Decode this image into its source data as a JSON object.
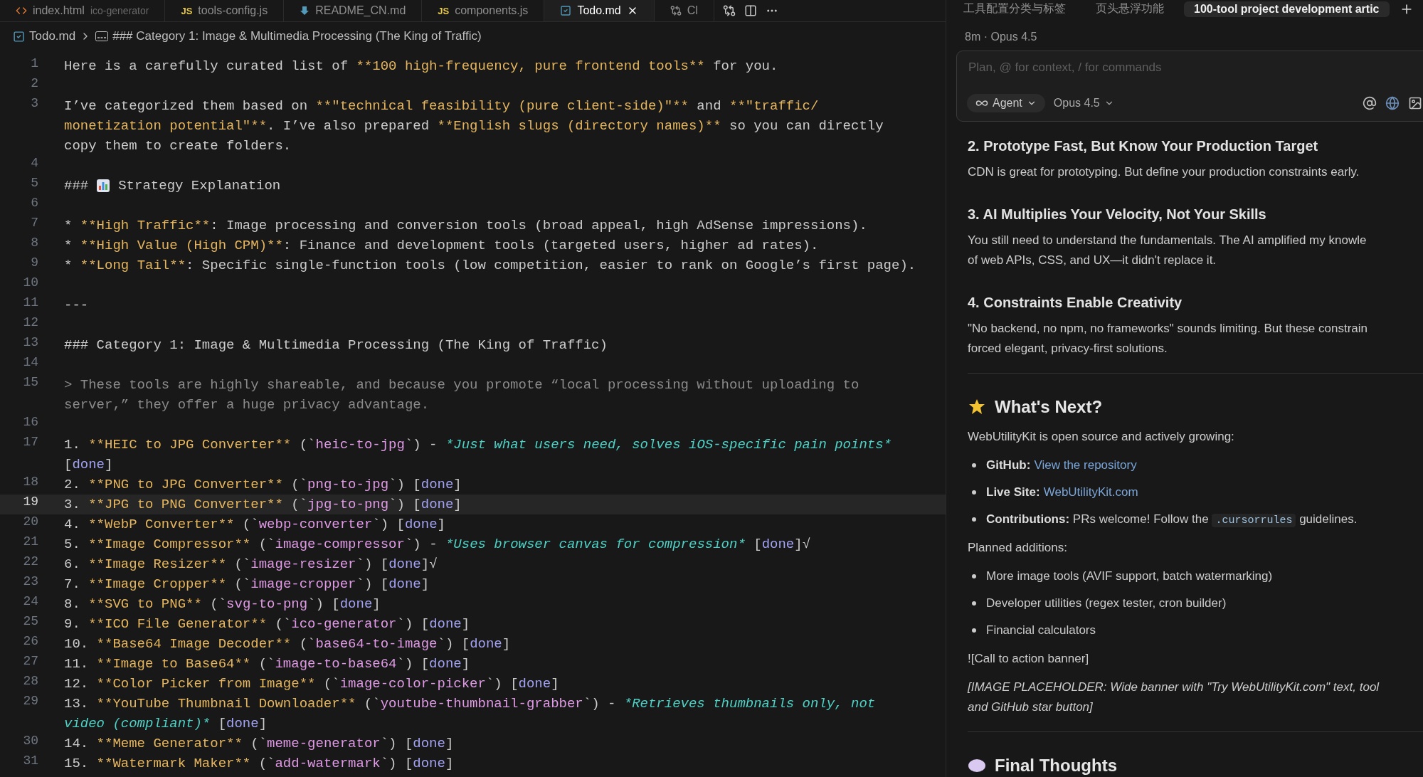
{
  "editor": {
    "tabs": [
      {
        "kind": "html",
        "label": "index.html",
        "detail": "ico-generator",
        "selected": false
      },
      {
        "kind": "js",
        "badge": "JS",
        "label": "tools-config.js",
        "selected": false
      },
      {
        "kind": "readme",
        "label": "README_CN.md",
        "selected": false
      },
      {
        "kind": "js",
        "badge": "JS",
        "label": "components.js",
        "selected": false
      },
      {
        "kind": "md",
        "label": "Todo.md",
        "selected": true
      },
      {
        "kind": "compare",
        "label": "Cl",
        "selected": false
      }
    ],
    "breadcrumb": {
      "file": "Todo.md",
      "symbol": "### Category 1: Image & Multimedia Processing (The King of Traffic)"
    },
    "lines": [
      {
        "number": "1",
        "current": false,
        "wrapped_rows": [
          {
            "segments": [
              {
                "kind": "text",
                "text": "Here is a carefully curated list of "
              },
              {
                "kind": "bold",
                "text": "**100 high-frequency, pure frontend tools**"
              },
              {
                "kind": "text",
                "text": " for you."
              }
            ]
          }
        ]
      },
      {
        "number": "2",
        "current": false
      },
      {
        "number": "3",
        "current": false,
        "wrapped_rows": [
          {
            "segments": [
              {
                "kind": "text",
                "text": "I’ve categorized them based on "
              },
              {
                "kind": "bold",
                "text": "**\"technical feasibility (pure client-side)\"**"
              },
              {
                "kind": "text",
                "text": " and "
              },
              {
                "kind": "bold",
                "text": "**\"traffic/"
              }
            ]
          },
          {
            "segments": [
              {
                "kind": "bold",
                "text": "monetization potential\"**"
              },
              {
                "kind": "text",
                "text": ". I’ve also prepared "
              },
              {
                "kind": "bold",
                "text": "**English slugs (directory names)**"
              },
              {
                "kind": "text",
                "text": " so you can directly"
              }
            ]
          },
          {
            "segments": [
              {
                "kind": "text",
                "text": "copy them to create folders."
              }
            ]
          }
        ]
      },
      {
        "number": "4",
        "current": false
      },
      {
        "number": "5",
        "current": false,
        "wrapped_rows": [
          {
            "segments": [
              {
                "kind": "text",
                "text": "###"
              },
              {
                "kind": "icon"
              },
              {
                "kind": "text",
                "text": "Strategy Explanation"
              }
            ]
          }
        ]
      },
      {
        "number": "6",
        "current": false
      },
      {
        "number": "7",
        "current": false,
        "wrapped_rows": [
          {
            "segments": [
              {
                "kind": "text",
                "text": "* "
              },
              {
                "kind": "bold",
                "text": "**High Traffic**"
              },
              {
                "kind": "text",
                "text": ": Image processing and conversion tools (broad appeal, high AdSense impressions)."
              }
            ]
          }
        ]
      },
      {
        "number": "8",
        "current": false,
        "wrapped_rows": [
          {
            "segments": [
              {
                "kind": "text",
                "text": "* "
              },
              {
                "kind": "bold",
                "text": "**High Value (High CPM)**"
              },
              {
                "kind": "text",
                "text": ": Finance and development tools (targeted users, higher ad rates)."
              }
            ]
          }
        ]
      },
      {
        "number": "9",
        "current": false,
        "wrapped_rows": [
          {
            "segments": [
              {
                "kind": "text",
                "text": "* "
              },
              {
                "kind": "bold",
                "text": "**Long Tail**"
              },
              {
                "kind": "text",
                "text": ": Specific single-function tools (low competition, easier to rank on Google’s first page)."
              }
            ]
          }
        ]
      },
      {
        "number": "10",
        "current": false
      },
      {
        "number": "11",
        "current": false,
        "wrapped_rows": [
          {
            "segments": [
              {
                "kind": "text",
                "text": "---"
              }
            ]
          }
        ]
      },
      {
        "number": "12",
        "current": false
      },
      {
        "number": "13",
        "current": false,
        "wrapped_rows": [
          {
            "segments": [
              {
                "kind": "text",
                "text": "### Category 1: Image & Multimedia Processing (The King of Traffic)"
              }
            ]
          }
        ]
      },
      {
        "number": "14",
        "current": false
      },
      {
        "number": "15",
        "current": false,
        "wrapped_rows": [
          {
            "segments": [
              {
                "kind": "quote",
                "text": "> These tools are highly shareable, and because you promote “local processing without uploading to"
              }
            ]
          },
          {
            "segments": [
              {
                "kind": "quote",
                "text": "server,” they offer a huge privacy advantage."
              }
            ]
          }
        ]
      },
      {
        "number": "16",
        "current": false
      },
      {
        "number": "17",
        "current": false,
        "wrapped_rows": [
          {
            "segments": [
              {
                "kind": "text",
                "text": "1. "
              },
              {
                "kind": "bold",
                "text": "**HEIC to JPG Converter**"
              },
              {
                "kind": "text",
                "text": " (`"
              },
              {
                "kind": "code",
                "text": "heic-to-jpg"
              },
              {
                "kind": "text",
                "text": "`) - "
              },
              {
                "kind": "italic",
                "text": "*Just what users need, solves iOS-specific pain points*"
              }
            ]
          },
          {
            "segments": [
              {
                "kind": "text",
                "text": "["
              },
              {
                "kind": "done",
                "text": "done"
              },
              {
                "kind": "text",
                "text": "]"
              }
            ]
          }
        ]
      },
      {
        "number": "18",
        "current": false,
        "wrapped_rows": [
          {
            "segments": [
              {
                "kind": "text",
                "text": "2. "
              },
              {
                "kind": "bold",
                "text": "**PNG to JPG Converter**"
              },
              {
                "kind": "text",
                "text": " (`"
              },
              {
                "kind": "code",
                "text": "png-to-jpg"
              },
              {
                "kind": "text",
                "text": "`) ["
              },
              {
                "kind": "done",
                "text": "done"
              },
              {
                "kind": "text",
                "text": "]"
              }
            ]
          }
        ]
      },
      {
        "number": "19",
        "current": true,
        "wrapped_rows": [
          {
            "segments": [
              {
                "kind": "text",
                "text": "3. "
              },
              {
                "kind": "bold",
                "text": "**JPG to PNG Converter**"
              },
              {
                "kind": "text",
                "text": " (`"
              },
              {
                "kind": "code",
                "text": "jpg-to-png"
              },
              {
                "kind": "text",
                "text": "`) ["
              },
              {
                "kind": "done",
                "text": "done"
              },
              {
                "kind": "text",
                "text": "]"
              }
            ]
          }
        ]
      },
      {
        "number": "20",
        "current": false,
        "wrapped_rows": [
          {
            "segments": [
              {
                "kind": "text",
                "text": "4. "
              },
              {
                "kind": "bold",
                "text": "**WebP Converter**"
              },
              {
                "kind": "text",
                "text": " (`"
              },
              {
                "kind": "code",
                "text": "webp-converter"
              },
              {
                "kind": "text",
                "text": "`) ["
              },
              {
                "kind": "done",
                "text": "done"
              },
              {
                "kind": "text",
                "text": "]"
              }
            ]
          }
        ]
      },
      {
        "number": "21",
        "current": false,
        "wrapped_rows": [
          {
            "segments": [
              {
                "kind": "text",
                "text": "5. "
              },
              {
                "kind": "bold",
                "text": "**Image Compressor**"
              },
              {
                "kind": "text",
                "text": " (`"
              },
              {
                "kind": "code",
                "text": "image-compressor"
              },
              {
                "kind": "text",
                "text": "`) - "
              },
              {
                "kind": "italic",
                "text": "*Uses browser canvas for compression*"
              },
              {
                "kind": "text",
                "text": " ["
              },
              {
                "kind": "done",
                "text": "done"
              },
              {
                "kind": "text",
                "text": "]√"
              }
            ]
          }
        ]
      },
      {
        "number": "22",
        "current": false,
        "wrapped_rows": [
          {
            "segments": [
              {
                "kind": "text",
                "text": "6. "
              },
              {
                "kind": "bold",
                "text": "**Image Resizer**"
              },
              {
                "kind": "text",
                "text": " (`"
              },
              {
                "kind": "code",
                "text": "image-resizer"
              },
              {
                "kind": "text",
                "text": "`) ["
              },
              {
                "kind": "done",
                "text": "done"
              },
              {
                "kind": "text",
                "text": "]√"
              }
            ]
          }
        ]
      },
      {
        "number": "23",
        "current": false,
        "wrapped_rows": [
          {
            "segments": [
              {
                "kind": "text",
                "text": "7. "
              },
              {
                "kind": "bold",
                "text": "**Image Cropper**"
              },
              {
                "kind": "text",
                "text": " (`"
              },
              {
                "kind": "code",
                "text": "image-cropper"
              },
              {
                "kind": "text",
                "text": "`) ["
              },
              {
                "kind": "done",
                "text": "done"
              },
              {
                "kind": "text",
                "text": "]"
              }
            ]
          }
        ]
      },
      {
        "number": "24",
        "current": false,
        "wrapped_rows": [
          {
            "segments": [
              {
                "kind": "text",
                "text": "8. "
              },
              {
                "kind": "bold",
                "text": "**SVG to PNG**"
              },
              {
                "kind": "text",
                "text": " (`"
              },
              {
                "kind": "code",
                "text": "svg-to-png"
              },
              {
                "kind": "text",
                "text": "`) ["
              },
              {
                "kind": "done",
                "text": "done"
              },
              {
                "kind": "text",
                "text": "]"
              }
            ]
          }
        ]
      },
      {
        "number": "25",
        "current": false,
        "wrapped_rows": [
          {
            "segments": [
              {
                "kind": "text",
                "text": "9. "
              },
              {
                "kind": "bold",
                "text": "**ICO File Generator**"
              },
              {
                "kind": "text",
                "text": " (`"
              },
              {
                "kind": "code",
                "text": "ico-generator"
              },
              {
                "kind": "text",
                "text": "`) ["
              },
              {
                "kind": "done",
                "text": "done"
              },
              {
                "kind": "text",
                "text": "]"
              }
            ]
          }
        ]
      },
      {
        "number": "26",
        "current": false,
        "wrapped_rows": [
          {
            "segments": [
              {
                "kind": "text",
                "text": "10. "
              },
              {
                "kind": "bold",
                "text": "**Base64 Image Decoder**"
              },
              {
                "kind": "text",
                "text": " (`"
              },
              {
                "kind": "code",
                "text": "base64-to-image"
              },
              {
                "kind": "text",
                "text": "`) ["
              },
              {
                "kind": "done",
                "text": "done"
              },
              {
                "kind": "text",
                "text": "]"
              }
            ]
          }
        ]
      },
      {
        "number": "27",
        "current": false,
        "wrapped_rows": [
          {
            "segments": [
              {
                "kind": "text",
                "text": "11. "
              },
              {
                "kind": "bold",
                "text": "**Image to Base64**"
              },
              {
                "kind": "text",
                "text": " (`"
              },
              {
                "kind": "code",
                "text": "image-to-base64"
              },
              {
                "kind": "text",
                "text": "`) ["
              },
              {
                "kind": "done",
                "text": "done"
              },
              {
                "kind": "text",
                "text": "]"
              }
            ]
          }
        ]
      },
      {
        "number": "28",
        "current": false,
        "wrapped_rows": [
          {
            "segments": [
              {
                "kind": "text",
                "text": "12. "
              },
              {
                "kind": "bold",
                "text": "**Color Picker from Image**"
              },
              {
                "kind": "text",
                "text": " (`"
              },
              {
                "kind": "code",
                "text": "image-color-picker"
              },
              {
                "kind": "text",
                "text": "`) ["
              },
              {
                "kind": "done",
                "text": "done"
              },
              {
                "kind": "text",
                "text": "]"
              }
            ]
          }
        ]
      },
      {
        "number": "29",
        "current": false,
        "wrapped_rows": [
          {
            "segments": [
              {
                "kind": "text",
                "text": "13. "
              },
              {
                "kind": "bold",
                "text": "**YouTube Thumbnail Downloader**"
              },
              {
                "kind": "text",
                "text": " (`"
              },
              {
                "kind": "code",
                "text": "youtube-thumbnail-grabber"
              },
              {
                "kind": "text",
                "text": "`) - "
              },
              {
                "kind": "italic",
                "text": "*Retrieves thumbnails only, not"
              }
            ]
          },
          {
            "segments": [
              {
                "kind": "italic",
                "text": "video (compliant)*"
              },
              {
                "kind": "text",
                "text": " ["
              },
              {
                "kind": "done",
                "text": "done"
              },
              {
                "kind": "text",
                "text": "]"
              }
            ]
          }
        ]
      },
      {
        "number": "30",
        "current": false,
        "wrapped_rows": [
          {
            "segments": [
              {
                "kind": "text",
                "text": "14. "
              },
              {
                "kind": "bold",
                "text": "**Meme Generator**"
              },
              {
                "kind": "text",
                "text": " (`"
              },
              {
                "kind": "code",
                "text": "meme-generator"
              },
              {
                "kind": "text",
                "text": "`) ["
              },
              {
                "kind": "done",
                "text": "done"
              },
              {
                "kind": "text",
                "text": "]"
              }
            ]
          }
        ]
      },
      {
        "number": "31",
        "current": false,
        "wrapped_rows": [
          {
            "segments": [
              {
                "kind": "text",
                "text": "15. "
              },
              {
                "kind": "bold",
                "text": "**Watermark Maker**"
              },
              {
                "kind": "text",
                "text": " (`"
              },
              {
                "kind": "code",
                "text": "add-watermark"
              },
              {
                "kind": "text",
                "text": "`) ["
              },
              {
                "kind": "done",
                "text": "done"
              },
              {
                "kind": "text",
                "text": "]"
              }
            ]
          }
        ]
      }
    ]
  },
  "chat": {
    "tabs": [
      {
        "label": "工具配置分类与标签",
        "selected": false
      },
      {
        "label": "页头悬浮功能",
        "selected": false
      },
      {
        "label": "100-tool project development artic",
        "selected": true
      }
    ],
    "meta": "8m · Opus 4.5",
    "input": {
      "placeholder": "Plan, @ for context, / for commands",
      "mode": "Agent",
      "model": "Opus 4.5"
    },
    "blocks": [
      {
        "kind": "h3",
        "text": "2. Prototype Fast, But Know Your Production Target"
      },
      {
        "kind": "p",
        "lines": [
          "CDN is great for prototyping. But define your production constraints early."
        ]
      },
      {
        "kind": "h3",
        "text": "3. AI Multiplies Your Velocity, Not Your Skills"
      },
      {
        "kind": "p",
        "lines": [
          "You still need to understand the fundamentals. The AI amplified my knowle",
          "of web APIs, CSS, and UX—it didn't replace it."
        ]
      },
      {
        "kind": "h3",
        "text": "4. Constraints Enable Creativity"
      },
      {
        "kind": "p",
        "lines": [
          "\"No backend, no npm, no frameworks\" sounds limiting. But these constrain",
          "forced elegant, privacy-first solutions."
        ]
      },
      {
        "kind": "hr"
      },
      {
        "kind": "h2",
        "text": "What's Next?"
      },
      {
        "kind": "p",
        "lines": [
          "WebUtilityKit is open source and actively growing:"
        ]
      },
      {
        "kind": "ul",
        "items": [
          {
            "segments": [
              {
                "kind": "bold",
                "text": "GitHub:"
              },
              {
                "kind": "link",
                "text": "View the repository"
              }
            ]
          },
          {
            "segments": [
              {
                "kind": "bold",
                "text": "Live Site:"
              },
              {
                "kind": "link",
                "text": "WebUtilityKit.com"
              }
            ]
          },
          {
            "segments": [
              {
                "kind": "bold",
                "text": "Contributions:"
              },
              {
                "kind": "text",
                "text": " PRs welcome! Follow the "
              },
              {
                "kind": "code",
                "text": ".cursorrules"
              },
              {
                "kind": "text",
                "text": " guidelines."
              }
            ]
          }
        ]
      },
      {
        "kind": "p",
        "lines": [
          "Planned additions:"
        ]
      },
      {
        "kind": "ul",
        "items": [
          {
            "segments": [
              {
                "kind": "text",
                "text": "More image tools (AVIF support, batch watermarking)"
              }
            ]
          },
          {
            "segments": [
              {
                "kind": "text",
                "text": "Developer utilities (regex tester, cron builder)"
              }
            ]
          },
          {
            "segments": [
              {
                "kind": "text",
                "text": "Financial calculators"
              }
            ]
          }
        ]
      },
      {
        "kind": "p",
        "lines": [
          "![Call to action banner]"
        ]
      },
      {
        "kind": "em",
        "lines": [
          "[IMAGE PLACEHOLDER: Wide banner with \"Try WebUtilityKit.com\" text, tool",
          "and GitHub star button]"
        ]
      },
      {
        "kind": "hr"
      },
      {
        "kind": "h2",
        "text": "Final Thoughts"
      }
    ]
  }
}
